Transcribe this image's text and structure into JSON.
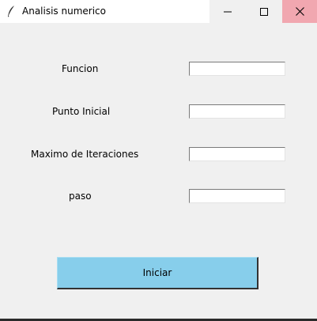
{
  "window": {
    "title": "Analisis numerico",
    "app_icon": "feather-icon",
    "controls": {
      "minimize_icon": "minimize-icon",
      "maximize_icon": "maximize-icon",
      "close_icon": "close-icon",
      "close_hover_color": "#f1a7b0"
    }
  },
  "form": {
    "fields": [
      {
        "label": "Funcion",
        "value": ""
      },
      {
        "label": "Punto Inicial",
        "value": ""
      },
      {
        "label": "Maximo de Iteraciones",
        "value": ""
      },
      {
        "label": "paso",
        "value": ""
      }
    ],
    "start_button": {
      "label": "Iniciar",
      "color": "#87ceeb"
    }
  }
}
